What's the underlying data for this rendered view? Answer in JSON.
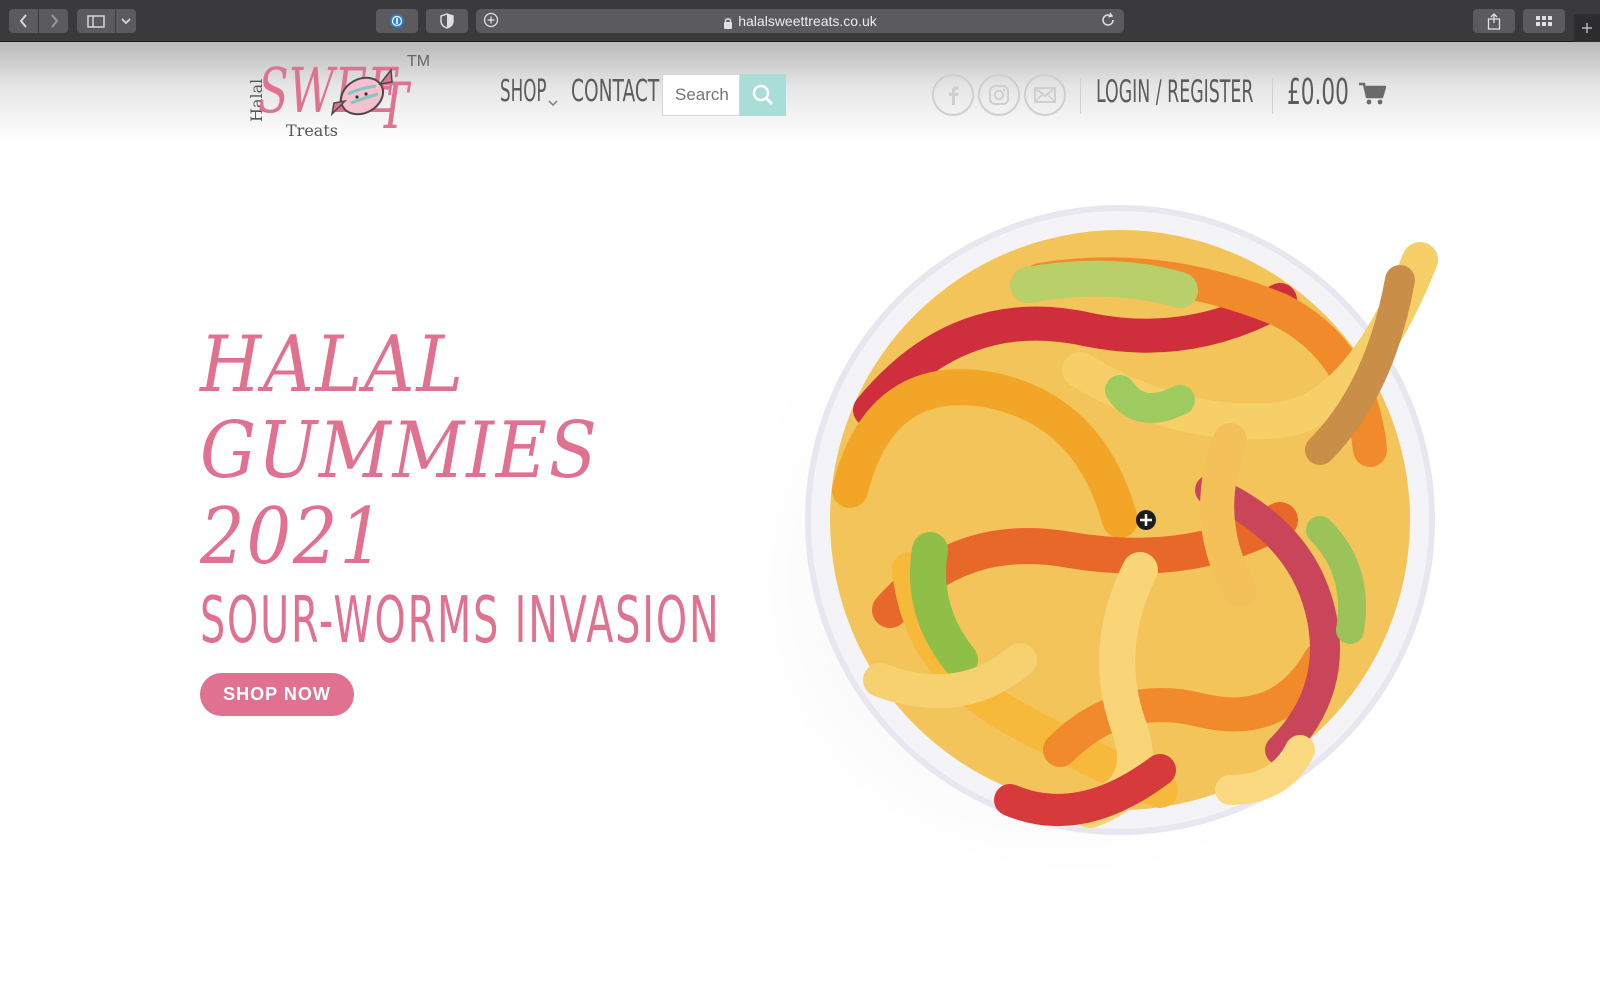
{
  "browser": {
    "url": "halalsweettreats.co.uk",
    "buttons": [
      "back",
      "forward",
      "sidebar",
      "sidebar-menu",
      "password",
      "shield",
      "share",
      "tabs",
      "new-tab"
    ]
  },
  "header": {
    "logo": {
      "word_halal": "Halal",
      "word_sweet": "SWEE",
      "word_t": "T",
      "word_treats": "Treats",
      "trademark": "TM"
    },
    "nav": {
      "shop": "SHOP",
      "contact": "CONTACT"
    },
    "search": {
      "placeholder": "Search"
    },
    "social": [
      "facebook-icon",
      "instagram-icon",
      "email-icon"
    ],
    "login": "LOGIN / REGISTER",
    "cart_total": "£0.00"
  },
  "hero": {
    "title_line1": "HALAL",
    "title_line2": "GUMMIES",
    "title_line3": "2021",
    "subtitle": "SOUR-WORMS INVASION",
    "cta": "SHOP NOW"
  },
  "colors": {
    "brand_pink": "#e07191",
    "search_button": "#a9ddd7",
    "nav_text": "#5c5c5c"
  }
}
